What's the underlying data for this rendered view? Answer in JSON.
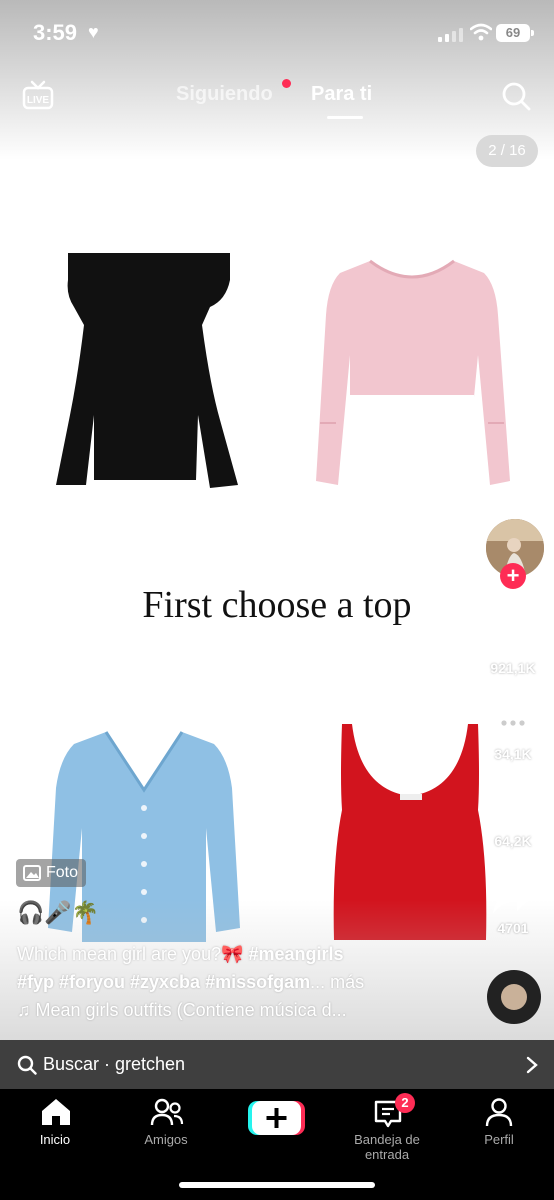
{
  "status_bar": {
    "time": "3:59",
    "battery": "69"
  },
  "header": {
    "live_label": "LIVE",
    "tab_following": "Siguiendo",
    "tab_for_you": "Para ti",
    "photo_counter": "2 / 16"
  },
  "post": {
    "caption": "First choose a top",
    "photo_badge": "Foto",
    "emojis": "🎧🎤🌴",
    "description_text": "Which mean girl are you?🎀 ",
    "hashtag_1": "#meangirls",
    "description_line2": "#fyp #foryou #zyxcba #missofgam",
    "more": "... más",
    "music": "Mean girls outfits (Contiene música d..."
  },
  "rail": {
    "likes": "921,1K",
    "comments": "34,1K",
    "saves": "64,2K",
    "shares": "4701"
  },
  "search_bar": {
    "text": "Buscar · gretchen"
  },
  "tab_bar": {
    "home": "Inicio",
    "friends": "Amigos",
    "inbox": "Bandeja de entrada",
    "inbox_badge": "2",
    "profile": "Perfil"
  },
  "colors": {
    "accent": "#fe2c55",
    "cyan": "#25f4ee"
  }
}
